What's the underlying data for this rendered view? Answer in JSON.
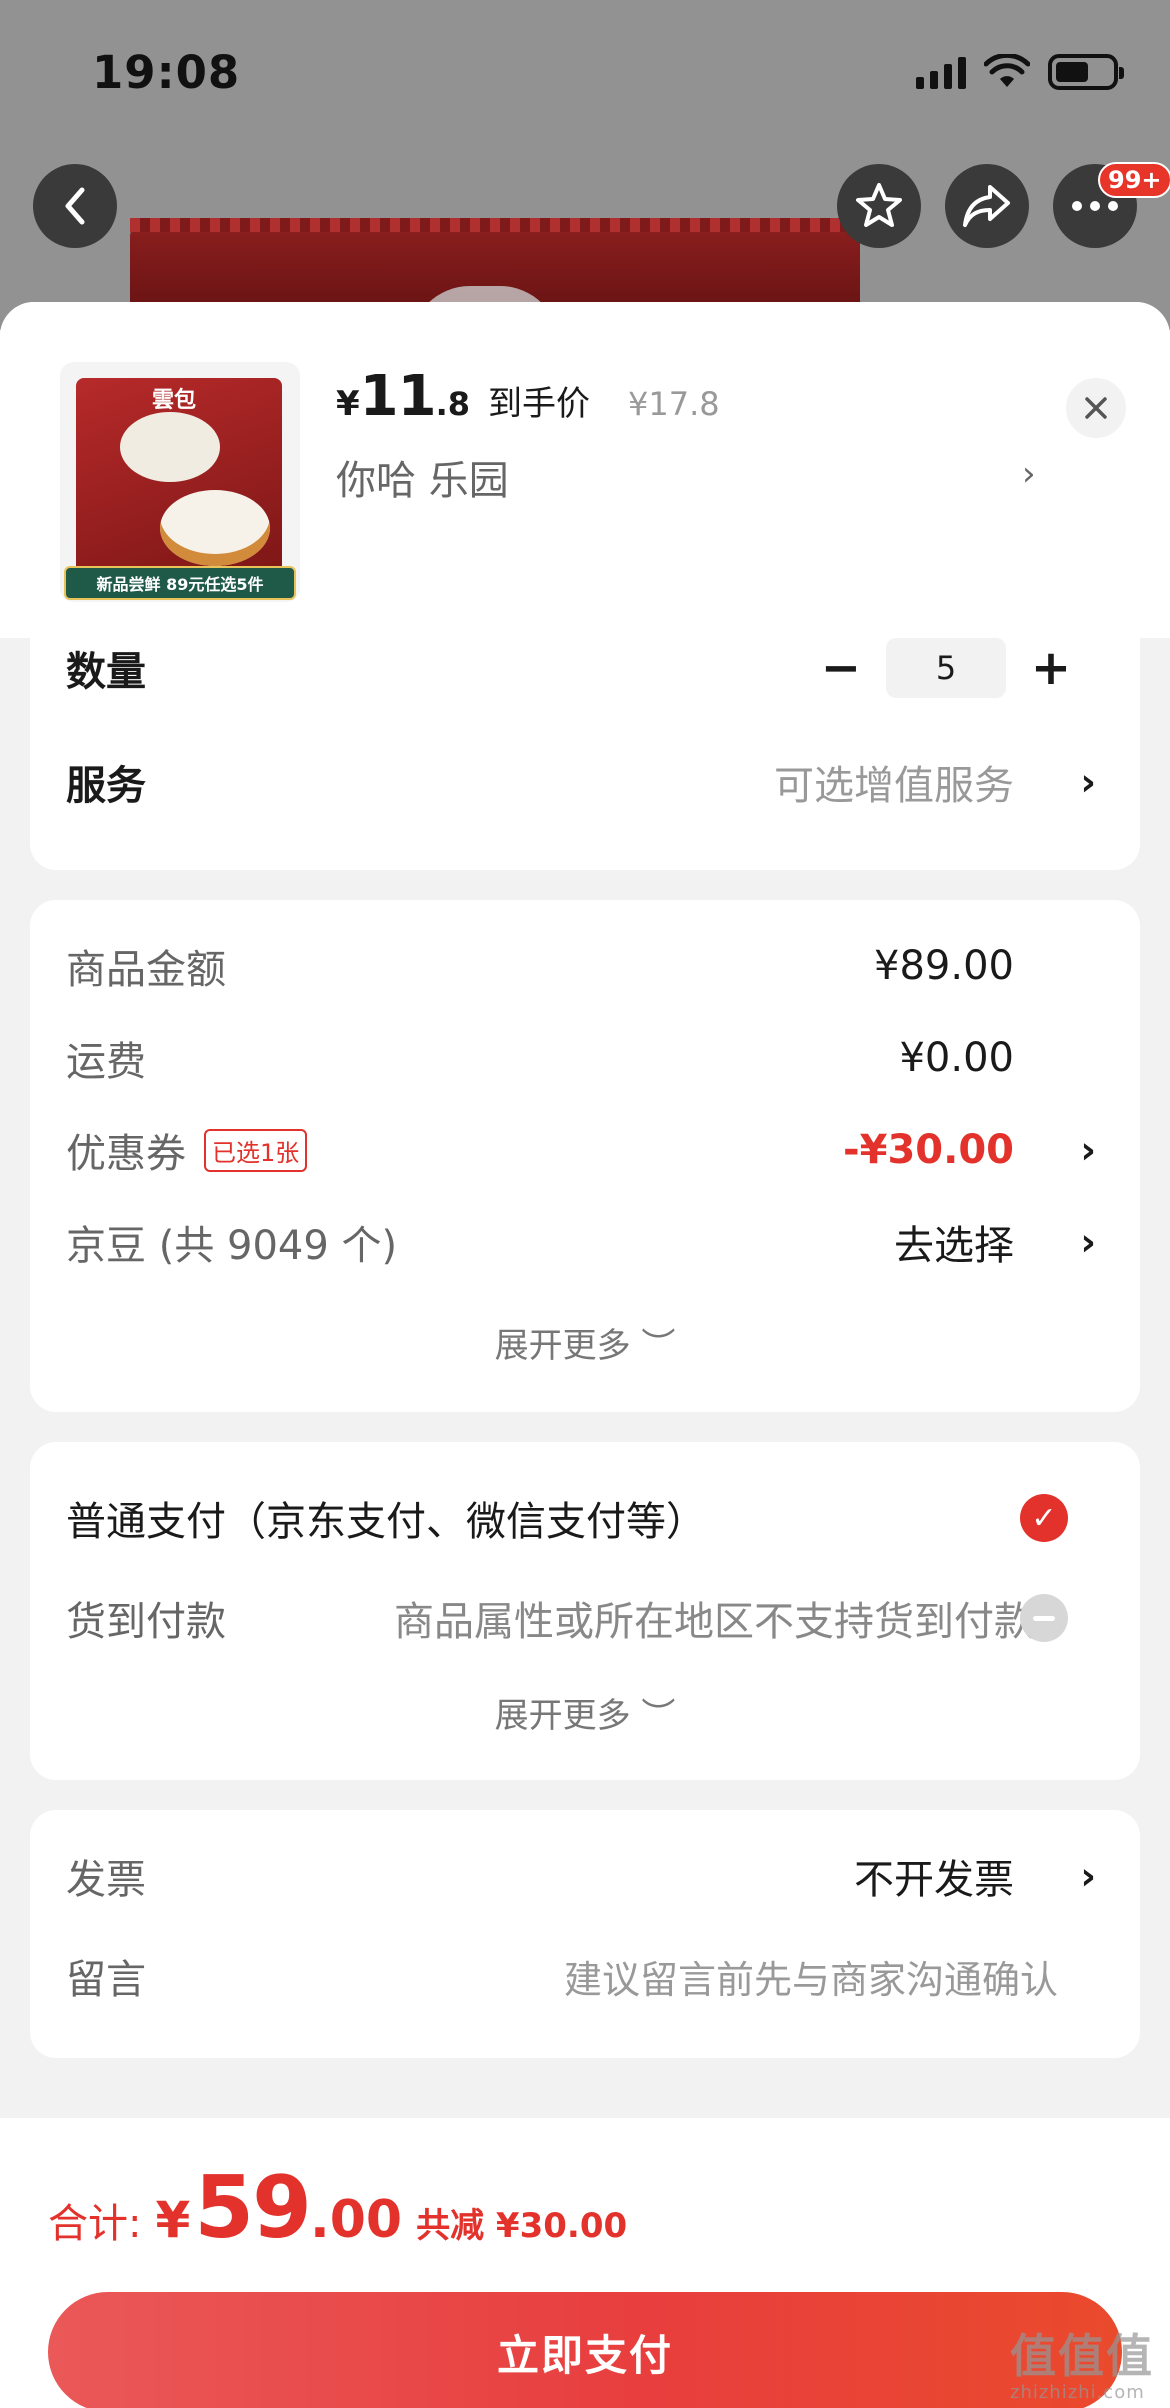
{
  "status_bar": {
    "time": "19:08"
  },
  "nav": {
    "more_badge": "99+"
  },
  "product": {
    "yen_symbol": "¥",
    "price_int": "11",
    "price_dec": ".8",
    "price_tag": "到手价",
    "original_price": "¥17.8",
    "spec": "你哈  乐园",
    "thumb_brand": "雲包",
    "thumb_banner": "新品尝鲜 89元任选5件"
  },
  "options": {
    "quantity_label": "数量",
    "quantity_value": "5",
    "service_label": "服务",
    "service_value": "可选增值服务"
  },
  "costs": {
    "goods_label": "商品金额",
    "goods_value": "¥89.00",
    "shipping_label": "运费",
    "shipping_value": "¥0.00",
    "coupon_label": "优惠券",
    "coupon_chip": "已选1张",
    "coupon_value": "-¥30.00",
    "jingdou_label": "京豆 (共 9049 个)",
    "jingdou_value": "去选择",
    "expand": "展开更多 ︶"
  },
  "payment": {
    "normal_label": "普通支付（京东支付、微信支付等）",
    "cod_label": "货到付款",
    "cod_note": "商品属性或所在地区不支持货到付款",
    "expand": "展开更多 ︶"
  },
  "extra": {
    "invoice_label": "发票",
    "invoice_value": "不开发票",
    "message_label": "留言",
    "message_placeholder": "建议留言前先与商家沟通确认"
  },
  "footer": {
    "total_label": "合计:",
    "total_yen": "¥",
    "total_int": "59",
    "total_dec": ".00",
    "total_save": "共减 ¥30.00",
    "pay_button": "立即支付"
  },
  "watermark": {
    "big": "值值值",
    "small": "zhizhizhi.com"
  },
  "colors": {
    "accent": "#e3312b",
    "background": "#f2f2f2"
  }
}
